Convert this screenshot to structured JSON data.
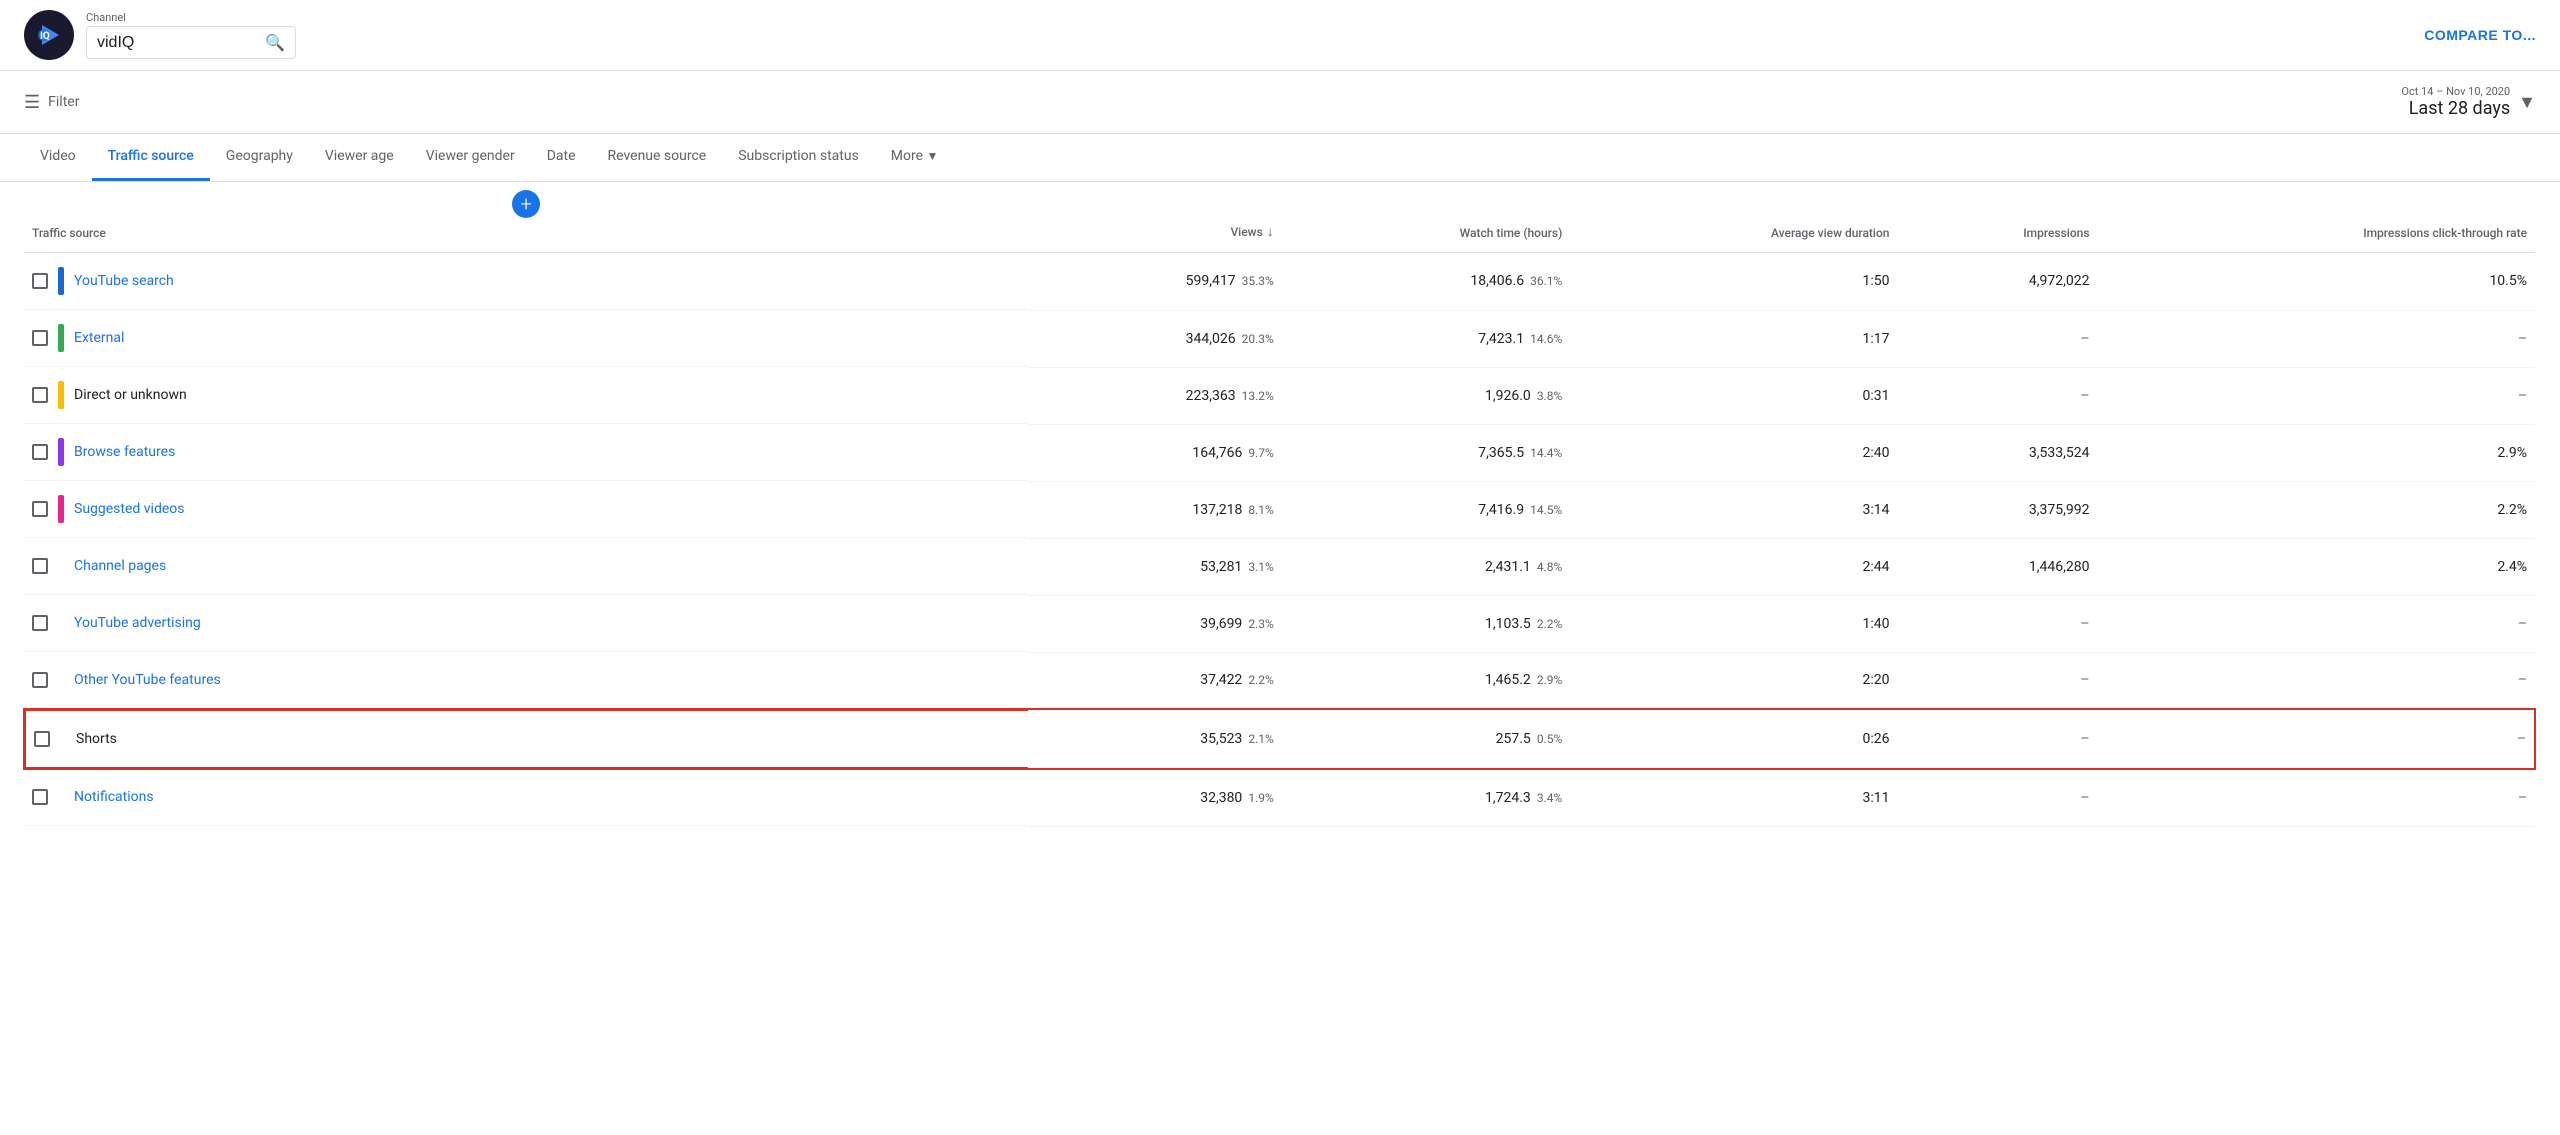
{
  "header": {
    "channel_label": "Channel",
    "search_value": "vidIQ",
    "compare_btn": "COMPARE TO..."
  },
  "filter": {
    "filter_label": "Filter",
    "date_range_label": "Oct 14 – Nov 10, 2020",
    "date_range_value": "Last 28 days"
  },
  "tabs": [
    {
      "id": "video",
      "label": "Video",
      "active": false
    },
    {
      "id": "traffic-source",
      "label": "Traffic source",
      "active": true
    },
    {
      "id": "geography",
      "label": "Geography",
      "active": false
    },
    {
      "id": "viewer-age",
      "label": "Viewer age",
      "active": false
    },
    {
      "id": "viewer-gender",
      "label": "Viewer gender",
      "active": false
    },
    {
      "id": "date",
      "label": "Date",
      "active": false
    },
    {
      "id": "revenue-source",
      "label": "Revenue source",
      "active": false
    },
    {
      "id": "subscription-status",
      "label": "Subscription status",
      "active": false
    },
    {
      "id": "more",
      "label": "More",
      "active": false
    }
  ],
  "table": {
    "columns": [
      {
        "id": "source",
        "label": "Traffic source"
      },
      {
        "id": "views",
        "label": "Views",
        "sortable": true
      },
      {
        "id": "watch-time",
        "label": "Watch time (hours)"
      },
      {
        "id": "avg-view",
        "label": "Average view duration"
      },
      {
        "id": "impressions",
        "label": "Impressions"
      },
      {
        "id": "ctr",
        "label": "Impressions click-through rate"
      }
    ],
    "rows": [
      {
        "id": "youtube-search",
        "source": "YouTube search",
        "isLink": true,
        "color": "#1967d2",
        "views": "599,417",
        "views_pct": "35.3%",
        "watch_time": "18,406.6",
        "watch_time_pct": "36.1%",
        "avg_view": "1:50",
        "impressions": "4,972,022",
        "ctr": "10.5%",
        "highlighted": false
      },
      {
        "id": "external",
        "source": "External",
        "isLink": true,
        "color": "#34a853",
        "views": "344,026",
        "views_pct": "20.3%",
        "watch_time": "7,423.1",
        "watch_time_pct": "14.6%",
        "avg_view": "1:17",
        "impressions": "–",
        "ctr": "–",
        "highlighted": false
      },
      {
        "id": "direct-unknown",
        "source": "Direct or unknown",
        "isLink": false,
        "color": "#fbbc04",
        "views": "223,363",
        "views_pct": "13.2%",
        "watch_time": "1,926.0",
        "watch_time_pct": "3.8%",
        "avg_view": "0:31",
        "impressions": "–",
        "ctr": "–",
        "highlighted": false
      },
      {
        "id": "browse-features",
        "source": "Browse features",
        "isLink": true,
        "color": "#9334e6",
        "views": "164,766",
        "views_pct": "9.7%",
        "watch_time": "7,365.5",
        "watch_time_pct": "14.4%",
        "avg_view": "2:40",
        "impressions": "3,533,524",
        "ctr": "2.9%",
        "highlighted": false
      },
      {
        "id": "suggested-videos",
        "source": "Suggested videos",
        "isLink": true,
        "color": "#e52592",
        "views": "137,218",
        "views_pct": "8.1%",
        "watch_time": "7,416.9",
        "watch_time_pct": "14.5%",
        "avg_view": "3:14",
        "impressions": "3,375,992",
        "ctr": "2.2%",
        "highlighted": false
      },
      {
        "id": "channel-pages",
        "source": "Channel pages",
        "isLink": true,
        "color": null,
        "views": "53,281",
        "views_pct": "3.1%",
        "watch_time": "2,431.1",
        "watch_time_pct": "4.8%",
        "avg_view": "2:44",
        "impressions": "1,446,280",
        "ctr": "2.4%",
        "highlighted": false
      },
      {
        "id": "youtube-advertising",
        "source": "YouTube advertising",
        "isLink": true,
        "color": null,
        "views": "39,699",
        "views_pct": "2.3%",
        "watch_time": "1,103.5",
        "watch_time_pct": "2.2%",
        "avg_view": "1:40",
        "impressions": "–",
        "ctr": "–",
        "highlighted": false
      },
      {
        "id": "other-youtube-features",
        "source": "Other YouTube features",
        "isLink": true,
        "color": null,
        "views": "37,422",
        "views_pct": "2.2%",
        "watch_time": "1,465.2",
        "watch_time_pct": "2.9%",
        "avg_view": "2:20",
        "impressions": "–",
        "ctr": "–",
        "highlighted": false
      },
      {
        "id": "shorts",
        "source": "Shorts",
        "isLink": false,
        "color": null,
        "views": "35,523",
        "views_pct": "2.1%",
        "watch_time": "257.5",
        "watch_time_pct": "0.5%",
        "avg_view": "0:26",
        "impressions": "–",
        "ctr": "–",
        "highlighted": true
      },
      {
        "id": "notifications",
        "source": "Notifications",
        "isLink": true,
        "color": null,
        "views": "32,380",
        "views_pct": "1.9%",
        "watch_time": "1,724.3",
        "watch_time_pct": "3.4%",
        "avg_view": "3:11",
        "impressions": "–",
        "ctr": "–",
        "highlighted": false
      }
    ]
  }
}
